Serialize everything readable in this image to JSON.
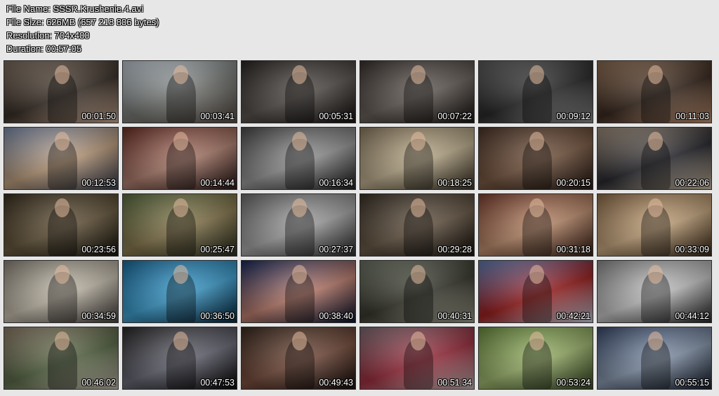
{
  "header": {
    "file_name": "File Name: SSSR.Krushenie.4.avi",
    "file_size": "File Size: 626MB (657 218 806 bytes)",
    "resolution": "Resolution: 704x400",
    "duration": "Duration: 00:57:05"
  },
  "thumbnails": [
    {
      "time": "00:01:50",
      "colors": [
        "#7a6a5c",
        "#3a3028",
        "#c8a890"
      ]
    },
    {
      "time": "00:03:41",
      "colors": [
        "#b9c3cc",
        "#7a7c78",
        "#5a5048"
      ]
    },
    {
      "time": "00:05:31",
      "colors": [
        "#2a2624",
        "#5a5450",
        "#1a1614"
      ]
    },
    {
      "time": "00:07:22",
      "colors": [
        "#3a3230",
        "#6a625c",
        "#1e1a18"
      ]
    },
    {
      "time": "00:09:12",
      "colors": [
        "#5a5a5a",
        "#2a2a2a",
        "#8a8a8a"
      ]
    },
    {
      "time": "00:11:03",
      "colors": [
        "#8a6a50",
        "#3a2a20",
        "#c09070"
      ]
    },
    {
      "time": "00:12:53",
      "colors": [
        "#7a8aa8",
        "#c0a080",
        "#3a4050"
      ]
    },
    {
      "time": "00:14:44",
      "colors": [
        "#6a3028",
        "#b08070",
        "#2a1a18"
      ]
    },
    {
      "time": "00:16:34",
      "colors": [
        "#4a4a4a",
        "#9a9a9a",
        "#222222"
      ]
    },
    {
      "time": "00:18:25",
      "colors": [
        "#8a7a60",
        "#c0b090",
        "#3a3428"
      ]
    },
    {
      "time": "00:20:15",
      "colors": [
        "#4a3428",
        "#7a5a44",
        "#2a1e18"
      ]
    },
    {
      "time": "00:22:06",
      "colors": [
        "#9a8a78",
        "#2a2a30",
        "#c8b8a0"
      ]
    },
    {
      "time": "00:23:56",
      "colors": [
        "#3a3020",
        "#6a5a40",
        "#1a1810"
      ]
    },
    {
      "time": "00:25:47",
      "colors": [
        "#5a6a40",
        "#8a7a50",
        "#2a3020"
      ]
    },
    {
      "time": "00:27:37",
      "colors": [
        "#6a6a6a",
        "#a8a8a8",
        "#303030"
      ]
    },
    {
      "time": "00:29:28",
      "colors": [
        "#3a3228",
        "#6a5a48",
        "#1a1610"
      ]
    },
    {
      "time": "00:31:18",
      "colors": [
        "#7a4030",
        "#c09070",
        "#3a2018"
      ]
    },
    {
      "time": "00:33:09",
      "colors": [
        "#8a6a48",
        "#c8a880",
        "#3a2a1a"
      ]
    },
    {
      "time": "00:34:59",
      "colors": [
        "#8a8478",
        "#c8c0b0",
        "#4a4440"
      ]
    },
    {
      "time": "00:36:50",
      "colors": [
        "#1a6a9a",
        "#40a0d0",
        "#0a2a40"
      ]
    },
    {
      "time": "00:38:40",
      "colors": [
        "#1a2a5a",
        "#c08070",
        "#0a1430"
      ]
    },
    {
      "time": "00:40:31",
      "colors": [
        "#6a7060",
        "#3a3a30",
        "#9a9a88"
      ]
    },
    {
      "time": "00:42:21",
      "colors": [
        "#5a7ab0",
        "#a02020",
        "#c0c8d8"
      ]
    },
    {
      "time": "00:44:12",
      "colors": [
        "#8a8a8a",
        "#c8c8c8",
        "#2a2a2a"
      ]
    },
    {
      "time": "00:46:02",
      "colors": [
        "#8a7a68",
        "#5a6a48",
        "#c0b8a8"
      ]
    },
    {
      "time": "00:47:53",
      "colors": [
        "#2a2a2a",
        "#6a6a78",
        "#0a0a0a"
      ]
    },
    {
      "time": "00:49:43",
      "colors": [
        "#3a2a20",
        "#7a5040",
        "#1a1210"
      ]
    },
    {
      "time": "00:51:34",
      "colors": [
        "#7a6a70",
        "#a03040",
        "#c0b0b0"
      ]
    },
    {
      "time": "00:53:24",
      "colors": [
        "#6a8a40",
        "#a0b870",
        "#3a4a28"
      ]
    },
    {
      "time": "00:55:15",
      "colors": [
        "#3a4a6a",
        "#8a9ab0",
        "#1a2230"
      ]
    }
  ]
}
